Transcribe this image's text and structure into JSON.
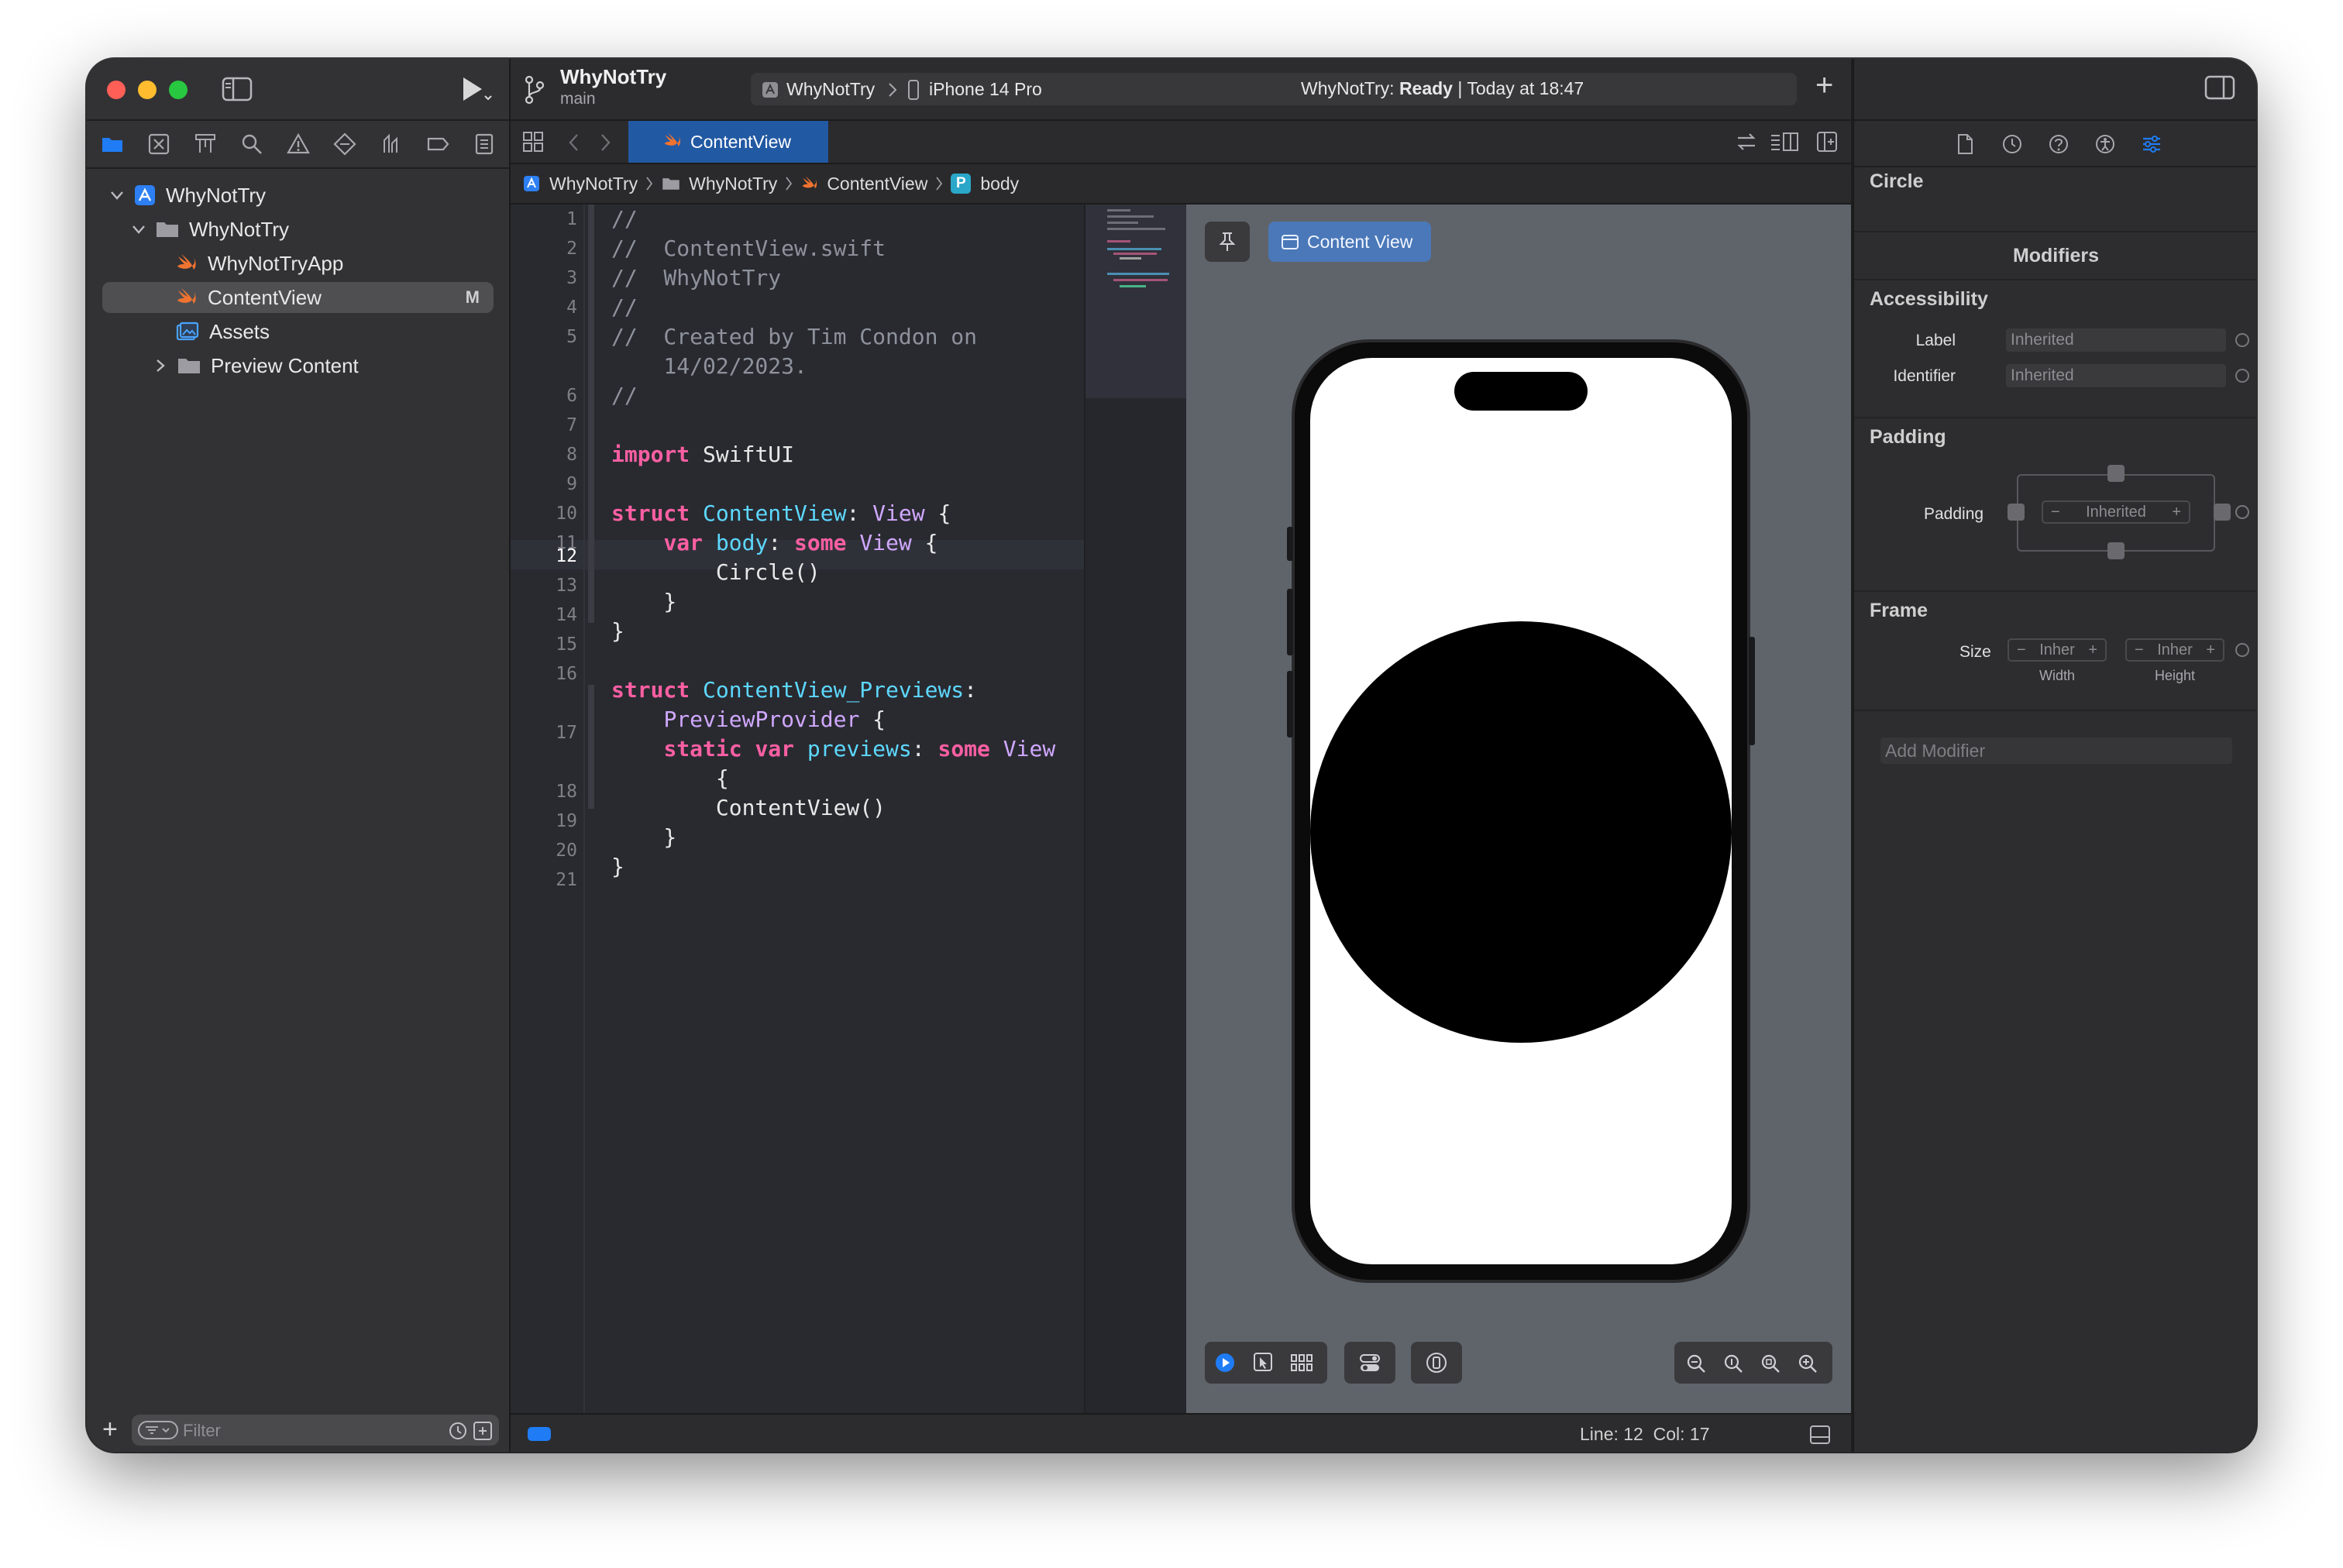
{
  "colors": {
    "accent": "#1f7cf5",
    "swift_orange": "#f0732f",
    "keyword": "#fc5fa3",
    "type": "#5dd8ff",
    "comment": "#8e929c",
    "preview_bg": "#5f646b"
  },
  "toolbar": {
    "project_name": "WhyNotTry",
    "branch": "main",
    "scheme": "WhyNotTry",
    "destination": "iPhone 14 Pro",
    "status_app": "WhyNotTry:",
    "status_state": "Ready",
    "status_time": "| Today at 18:47",
    "add_label": "+"
  },
  "navigator": {
    "items": [
      {
        "label": "WhyNotTry",
        "icon": "project-icon"
      },
      {
        "label": "WhyNotTry",
        "icon": "folder-icon"
      },
      {
        "label": "WhyNotTryApp",
        "icon": "swift-file-icon"
      },
      {
        "label": "ContentView",
        "icon": "swift-file-icon",
        "badge": "M"
      },
      {
        "label": "Assets",
        "icon": "asset-catalog-icon"
      },
      {
        "label": "Preview Content",
        "icon": "folder-icon"
      }
    ],
    "filter_placeholder": "Filter",
    "add_label": "+"
  },
  "tab": {
    "label": "ContentView"
  },
  "jump_bar": {
    "items": [
      "WhyNotTry",
      "WhyNotTry",
      "ContentView",
      "body"
    ],
    "badge": "P"
  },
  "code": {
    "line_numbers": [
      "1",
      "2",
      "3",
      "4",
      "5",
      "6",
      "7",
      "8",
      "9",
      "10",
      "11",
      "12",
      "13",
      "14",
      "15",
      "16",
      "17",
      "18",
      "19",
      "20",
      "21"
    ],
    "current_line": "12"
  },
  "preview": {
    "chip_label": "Content View"
  },
  "status": {
    "position": "Line: 12  Col: 17"
  },
  "inspector": {
    "view_name": "Circle",
    "modifiers_title": "Modifiers",
    "accessibility_title": "Accessibility",
    "label_label": "Label",
    "label_placeholder": "Inherited",
    "identifier_label": "Identifier",
    "identifier_placeholder": "Inherited",
    "padding_title": "Padding",
    "padding_label": "Padding",
    "padding_value": "Inherited",
    "frame_title": "Frame",
    "size_label": "Size",
    "width_value": "Inher",
    "height_value": "Inher",
    "width_caption": "Width",
    "height_caption": "Height",
    "add_modifier_placeholder": "Add Modifier",
    "minus": "−",
    "plus": "+"
  }
}
